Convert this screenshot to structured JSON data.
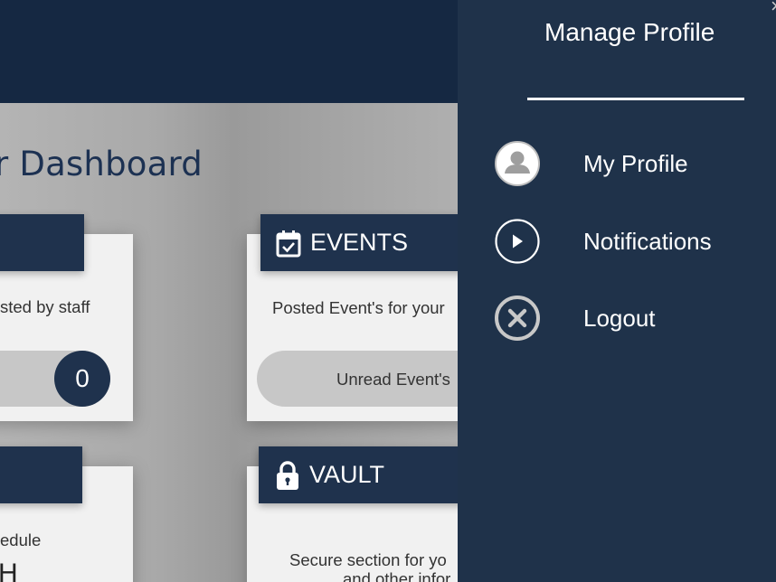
{
  "header": {
    "app_bar": ""
  },
  "dashboard": {
    "title": "r Dashboard",
    "cards": {
      "announcements": {
        "text": "sted by staff",
        "counter": "0"
      },
      "events": {
        "heading": "EVENTS",
        "icon": "calendar-check-icon",
        "text": "Posted Event's for your",
        "pill_label": "Unread Event's"
      },
      "schedule": {
        "text": "edule",
        "big_letter": "H"
      },
      "vault": {
        "heading": "VAULT",
        "icon": "lock-icon",
        "text_line1": "Secure section for yo",
        "text_line2": "and other infor"
      }
    }
  },
  "panel": {
    "title": "Manage Profile",
    "close_glyph": "×",
    "items": [
      {
        "label": "My Profile",
        "icon": "user-avatar-icon"
      },
      {
        "label": "Notifications",
        "icon": "play-circle-icon"
      },
      {
        "label": "Logout",
        "icon": "close-circle-icon"
      }
    ]
  },
  "colors": {
    "navy": "#152842",
    "panel": "#1f324a",
    "card_header": "#1f324d",
    "card_bg": "#f1f1f1"
  }
}
